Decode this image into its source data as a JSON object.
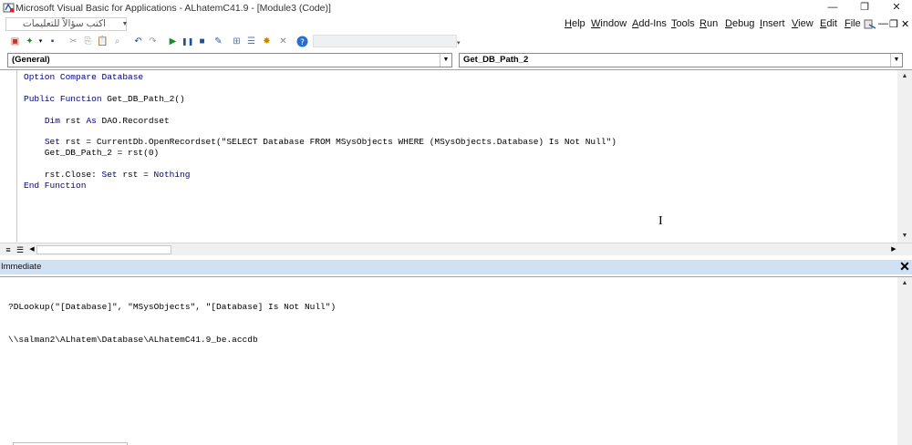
{
  "window": {
    "title": "Microsoft Visual Basic for Applications - ALhatemC41.9 - [Module3 (Code)]",
    "controls": [
      "—",
      "❐",
      "✕"
    ]
  },
  "menubar": {
    "ask_placeholder": "اكتب سؤالاً للتعليمات",
    "items": [
      "Help",
      "Window",
      "Add-Ins",
      "Tools",
      "Run",
      "Debug",
      "Insert",
      "View",
      "Edit",
      "File"
    ],
    "mdi_controls": [
      "—",
      "❐",
      "✕"
    ]
  },
  "combos": {
    "object": "(General)",
    "procedure": "Get_DB_Path_2"
  },
  "code": {
    "lines": [
      [
        {
          "t": "Option Compare Database",
          "k": true
        }
      ],
      [],
      [
        {
          "t": "Public Function",
          "k": true
        },
        {
          "t": " Get_DB_Path_2()"
        }
      ],
      [],
      [
        {
          "t": "    "
        },
        {
          "t": "Dim",
          "k": true
        },
        {
          "t": " rst "
        },
        {
          "t": "As",
          "k": true
        },
        {
          "t": " DAO.Recordset"
        }
      ],
      [],
      [
        {
          "t": "    "
        },
        {
          "t": "Set",
          "k": true
        },
        {
          "t": " rst = CurrentDb.OpenRecordset(\"SELECT Database FROM MSysObjects WHERE (MSysObjects.Database) Is Not Null\")"
        }
      ],
      [
        {
          "t": "    Get_DB_Path_2 = rst(0)"
        }
      ],
      [],
      [
        {
          "t": "    rst.Close: "
        },
        {
          "t": "Set",
          "k": true
        },
        {
          "t": " rst = "
        },
        {
          "t": "Nothing",
          "k": true
        }
      ],
      [
        {
          "t": "End Function",
          "k": true
        }
      ]
    ]
  },
  "immediate": {
    "title": "Immediate",
    "lines": [
      "?DLookup(\"[Database]\", \"MSysObjects\", \"[Database] Is Not Null\")",
      "\\\\salman2\\ALhatem\\Database\\ALhatemC41.9_be.accdb"
    ]
  },
  "colors": {
    "keyword": "#00007f",
    "immediate_header": "#cfe1f3"
  }
}
